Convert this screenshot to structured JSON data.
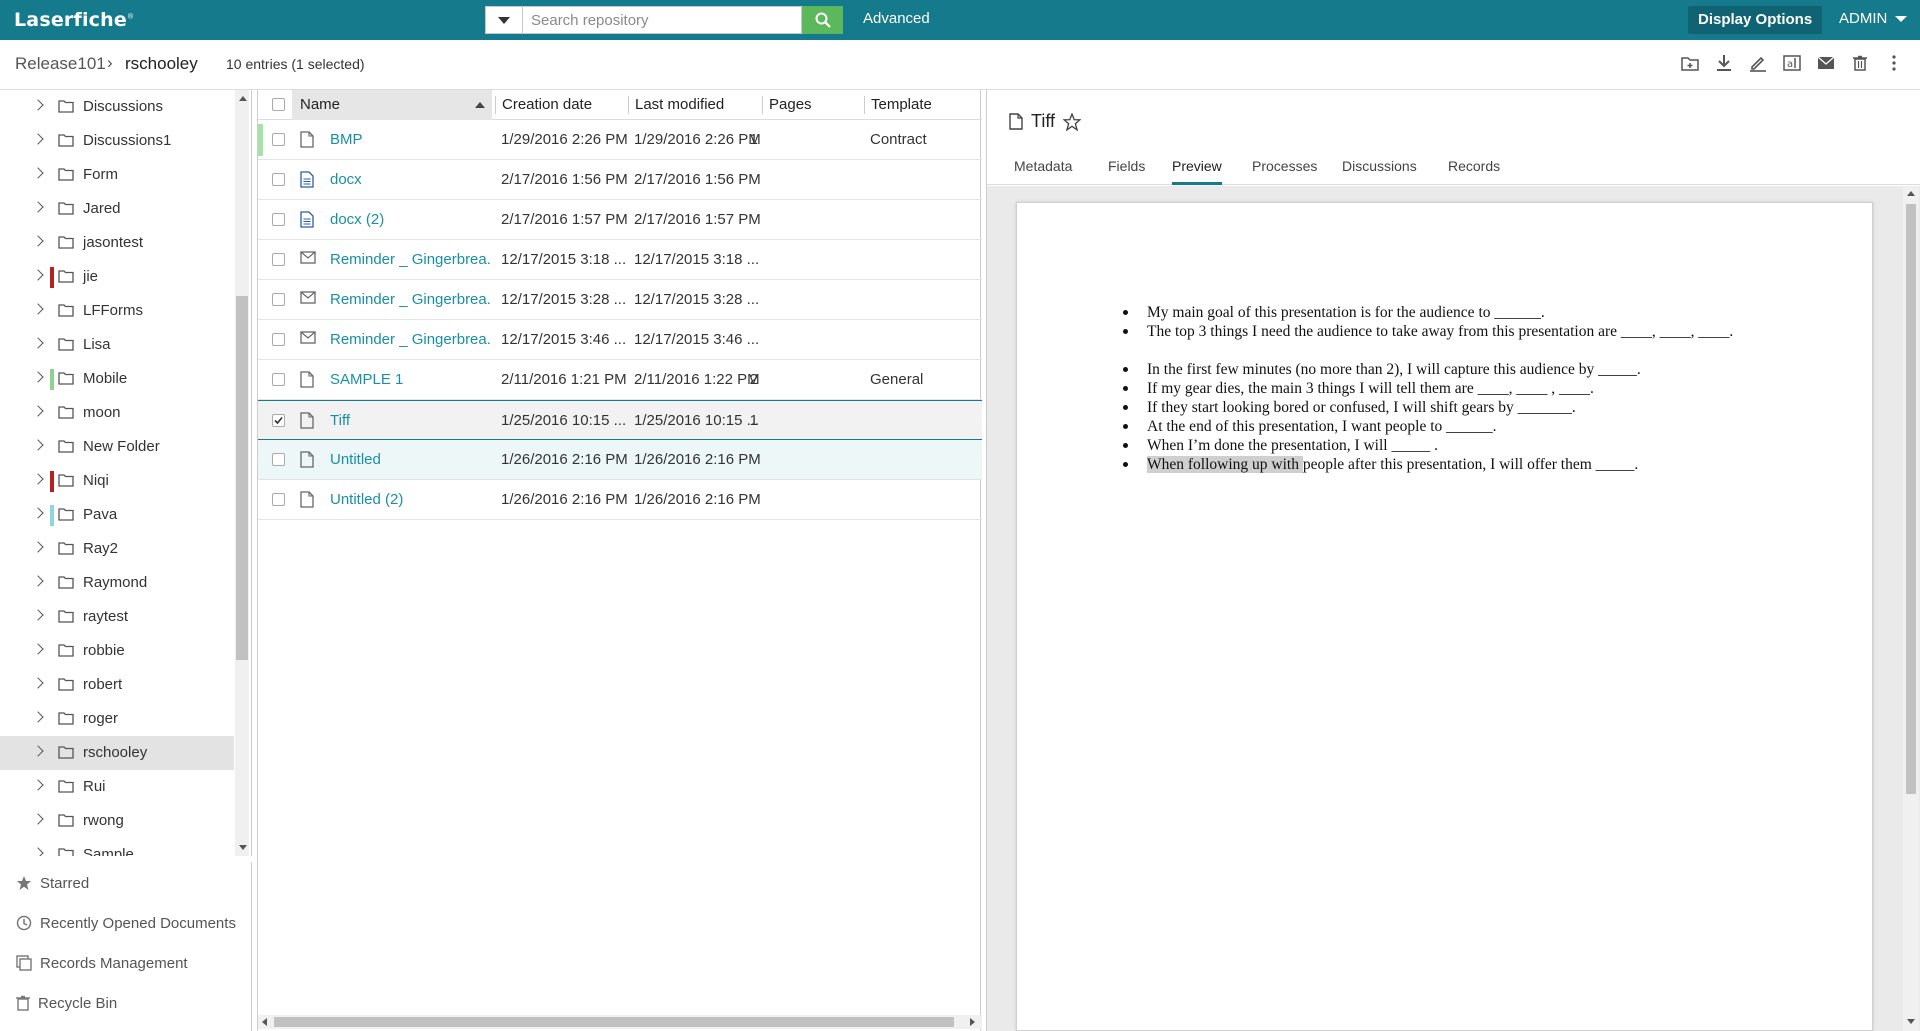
{
  "app": {
    "logo": "Laserfiche",
    "logo_mark": "®"
  },
  "search": {
    "placeholder": "Search repository",
    "value": "",
    "advanced_label": "Advanced"
  },
  "header": {
    "display_options_label": "Display Options",
    "user_label": "ADMIN"
  },
  "breadcrumb": {
    "root": "Release101",
    "separator": "›",
    "current": "rschooley",
    "entries_text": "10 entries (1 selected)"
  },
  "toolbar": [
    "new-folder-icon",
    "download-icon",
    "sign-icon",
    "text-icon",
    "email-icon",
    "delete-icon",
    "more-icon"
  ],
  "tree": {
    "items": [
      {
        "label": "Discussions",
        "mark": ""
      },
      {
        "label": "Discussions1",
        "mark": ""
      },
      {
        "label": "Form",
        "mark": ""
      },
      {
        "label": "Jared",
        "mark": ""
      },
      {
        "label": "jasontest",
        "mark": ""
      },
      {
        "label": "jie",
        "mark": "#b22222"
      },
      {
        "label": "LFForms",
        "mark": ""
      },
      {
        "label": "Lisa",
        "mark": ""
      },
      {
        "label": "Mobile",
        "mark": "#8fd18f"
      },
      {
        "label": "moon",
        "mark": ""
      },
      {
        "label": "New Folder",
        "mark": ""
      },
      {
        "label": "Niqi",
        "mark": "#b22222"
      },
      {
        "label": "Pava",
        "mark": "#8fd4e0"
      },
      {
        "label": "Ray2",
        "mark": ""
      },
      {
        "label": "Raymond",
        "mark": ""
      },
      {
        "label": "raytest",
        "mark": ""
      },
      {
        "label": "robbie",
        "mark": ""
      },
      {
        "label": "robert",
        "mark": ""
      },
      {
        "label": "roger",
        "mark": ""
      },
      {
        "label": "rschooley",
        "mark": "",
        "selected": true
      },
      {
        "label": "Rui",
        "mark": ""
      },
      {
        "label": "rwong",
        "mark": ""
      },
      {
        "label": "Sample",
        "mark": ""
      }
    ]
  },
  "bottom_nav": {
    "starred": "Starred",
    "recent": "Recently Opened Documents",
    "records": "Records Management",
    "recycle": "Recycle Bin"
  },
  "filelist": {
    "columns": {
      "name": "Name",
      "created": "Creation date",
      "modified": "Last modified",
      "pages": "Pages",
      "template": "Template"
    },
    "rows": [
      {
        "name": "BMP",
        "created": "1/29/2016 2:26 PM",
        "modified": "1/29/2016 2:26 PM",
        "pages": "1",
        "template": "Contract",
        "icon": "document-icon",
        "bar": "#a6e3a6"
      },
      {
        "name": "docx",
        "created": "2/17/2016 1:56 PM",
        "modified": "2/17/2016 1:56 PM",
        "pages": "",
        "template": "",
        "icon": "text-document-icon",
        "bar": ""
      },
      {
        "name": "docx (2)",
        "created": "2/17/2016 1:57 PM",
        "modified": "2/17/2016 1:57 PM",
        "pages": "",
        "template": "",
        "icon": "text-document-icon",
        "bar": ""
      },
      {
        "name": "Reminder _ Gingerbrea...",
        "created": "12/17/2015 3:18 ...",
        "modified": "12/17/2015 3:18 ...",
        "pages": "",
        "template": "",
        "icon": "email-icon",
        "bar": ""
      },
      {
        "name": "Reminder _ Gingerbrea...",
        "created": "12/17/2015 3:28 ...",
        "modified": "12/17/2015 3:28 ...",
        "pages": "",
        "template": "",
        "icon": "email-icon",
        "bar": ""
      },
      {
        "name": "Reminder _ Gingerbrea...",
        "created": "12/17/2015 3:46 ...",
        "modified": "12/17/2015 3:46 ...",
        "pages": "",
        "template": "",
        "icon": "email-icon",
        "bar": ""
      },
      {
        "name": "SAMPLE 1",
        "created": "2/11/2016 1:21 PM",
        "modified": "2/11/2016 1:22 PM",
        "pages": "2",
        "template": "General",
        "icon": "document-icon",
        "bar": ""
      },
      {
        "name": "Tiff",
        "created": "1/25/2016 10:15 ...",
        "modified": "1/25/2016 10:15 ...",
        "pages": "1",
        "template": "",
        "icon": "document-icon",
        "bar": "",
        "selected": true
      },
      {
        "name": "Untitled",
        "created": "1/26/2016 2:16 PM",
        "modified": "1/26/2016 2:16 PM",
        "pages": "",
        "template": "",
        "icon": "document-icon",
        "bar": "",
        "hover": true
      },
      {
        "name": "Untitled (2)",
        "created": "1/26/2016 2:16 PM",
        "modified": "1/26/2016 2:16 PM",
        "pages": "",
        "template": "",
        "icon": "document-icon",
        "bar": ""
      }
    ]
  },
  "preview": {
    "title": "Tiff",
    "tabs": [
      {
        "label": "Metadata"
      },
      {
        "label": "Fields"
      },
      {
        "label": "Preview",
        "active": true
      },
      {
        "label": "Processes"
      },
      {
        "label": "Discussions"
      },
      {
        "label": "Records"
      }
    ],
    "document_lines": [
      "My main goal of this presentation is for the audience to ______.",
      "The top 3 things I need the audience to take away from this presentation are ____, ____, ____.",
      "In the first few minutes (no more than 2), I will capture this audience by _____.",
      "If my gear dies, the main 3 things I will tell them are ____, ____ , ____.",
      "If they start looking bored or confused, I will shift gears by _______.",
      "At the end of this presentation, I want people to ______.",
      "When I’m done the presentation, I will _____ .",
      "people after this presentation, I will offer them _____."
    ],
    "highlighted_text": "When following up with "
  },
  "colors": {
    "accent": "#157a8c",
    "search_button": "#5cb85c",
    "link": "#1a8fa3"
  }
}
